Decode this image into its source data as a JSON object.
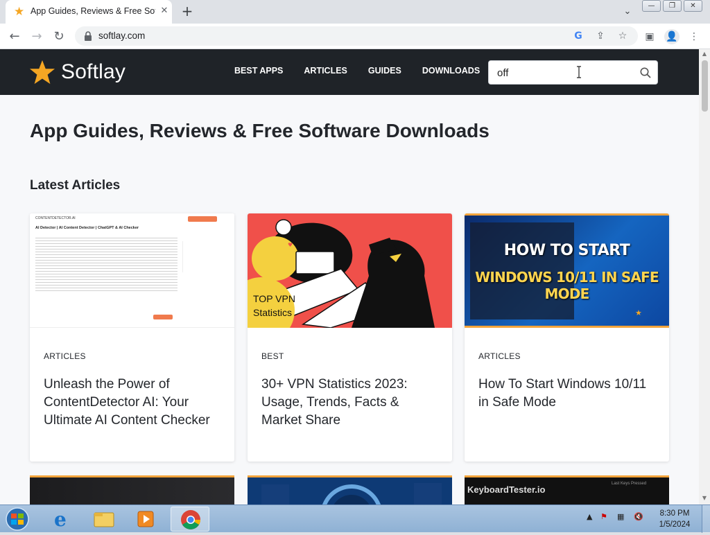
{
  "browser": {
    "tab_title": "App Guides, Reviews & Free Soft",
    "url": "softlay.com",
    "window_buttons": [
      "—",
      "❐",
      "✕"
    ]
  },
  "site": {
    "logo_text": "Softlay",
    "nav": [
      "BEST APPS",
      "ARTICLES",
      "GUIDES",
      "DOWNLOADS"
    ],
    "search_value": "off",
    "page_title": "App Guides, Reviews & Free Software Downloads",
    "section_title": "Latest Articles",
    "cards": [
      {
        "category": "ARTICLES",
        "title": "Unleash the Power of ContentDetector AI: Your Ultimate AI Content Checker",
        "image_header": "CONTENTDETECTOR.AI",
        "image_heading": "AI Detector | AI Content Detector | ChatGPT & AI Checker"
      },
      {
        "category": "BEST",
        "title": "30+ VPN Statistics 2023: Usage, Trends, Facts & Market Share",
        "image_badge": "TOP VPN Statistics"
      },
      {
        "category": "ARTICLES",
        "title": "How To Start Windows 10/11 in Safe Mode",
        "image_line1": "HOW TO START",
        "image_line2": "WINDOWS 10/11 IN SAFE MODE"
      }
    ],
    "partial_cards": [
      {
        "image_text": ""
      },
      {
        "image_text": ""
      },
      {
        "image_text": "KeyboardTester.io",
        "image_subtext": "Last Keys Pressed"
      }
    ]
  },
  "taskbar": {
    "time": "8:30 PM",
    "date": "1/5/2024"
  },
  "colors": {
    "header_bg": "#1f2328",
    "accent_orange": "#f2a33a",
    "star_yellow": "#f5a623"
  }
}
